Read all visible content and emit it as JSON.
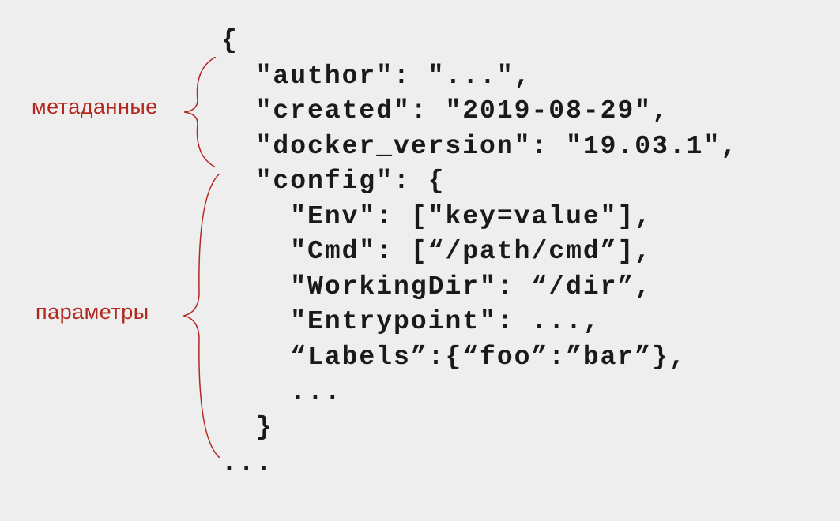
{
  "labels": {
    "metadata": "метаданные",
    "parameters": "параметры"
  },
  "code": {
    "line0": "{",
    "line1": "  \"author\": \"...\",",
    "line2": "  \"created\": \"2019-08-29\",",
    "line3": "  \"docker_version\": \"19.03.1\",",
    "line4": "  \"config\": {",
    "line5": "    \"Env\": [\"key=value\"],",
    "line6": "    \"Cmd\": [“/path/cmd”],",
    "line7": "    \"WorkingDir\": “/dir”,",
    "line8": "    \"Entrypoint\": ...,",
    "line9": "    “Labels”:{“foo”:”bar”},",
    "line10": "    ...",
    "line11": "  }",
    "line12": "..."
  }
}
